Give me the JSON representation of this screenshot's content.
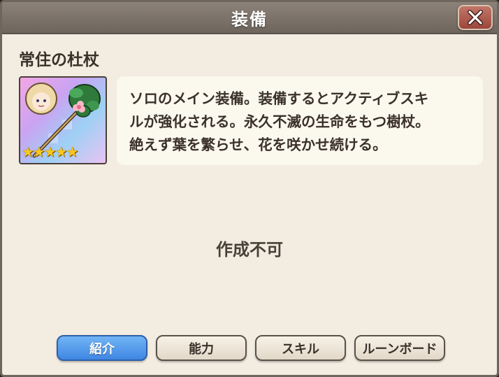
{
  "dialog": {
    "title": "装備",
    "close_icon": "close-icon"
  },
  "item": {
    "name": "常住の杜杖",
    "rarity_stars": 5,
    "star_glyphs": "★★★★★",
    "description_lines": [
      "ソロのメイン装備。装備するとアクティブスキ",
      "ルが強化される。永久不滅の生命をもつ樹杖。",
      "絶えず葉を繁らせ、花を咲かせ続ける。"
    ]
  },
  "status_text": "作成不可",
  "tabs": [
    {
      "label": "紹介",
      "active": true
    },
    {
      "label": "能力",
      "active": false
    },
    {
      "label": "スキル",
      "active": false
    },
    {
      "label": "ルーンボード",
      "active": false
    }
  ],
  "colors": {
    "panel_bg": "#f2ece1",
    "titlebar": "#7a7068",
    "close_button": "#b0594d",
    "active_tab": "#4a90e6"
  }
}
